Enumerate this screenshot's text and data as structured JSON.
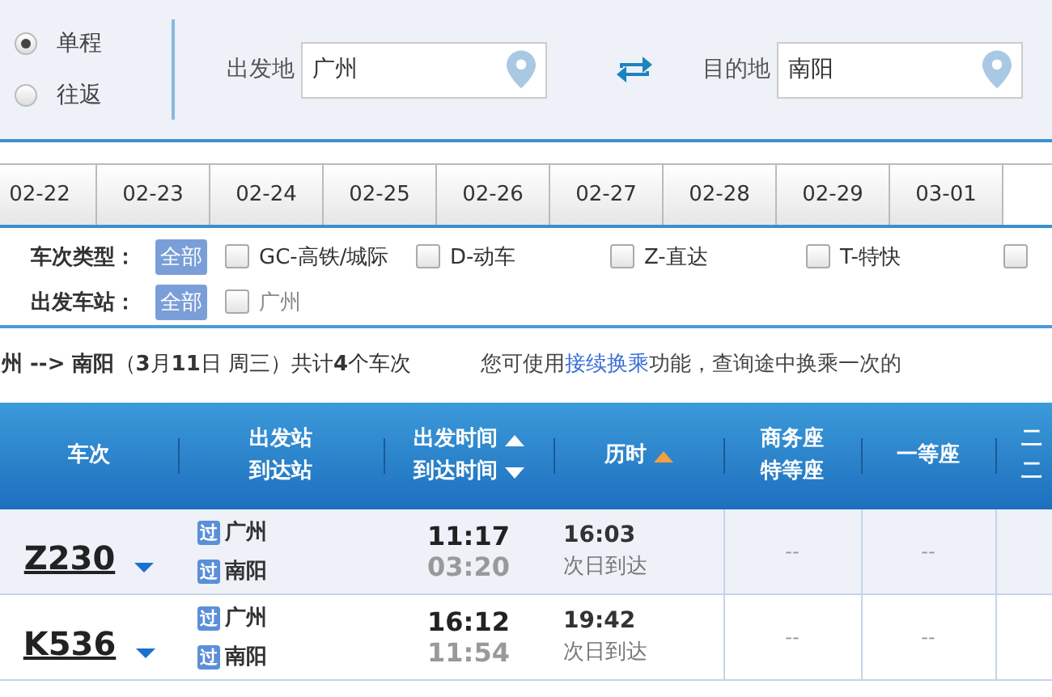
{
  "trip_type": [
    {
      "label": "单程",
      "selected": true
    },
    {
      "label": "往返",
      "selected": false
    }
  ],
  "from": {
    "label": "出发地",
    "value": "广州"
  },
  "to": {
    "label": "目的地",
    "value": "南阳"
  },
  "dates": [
    "02-22",
    "02-23",
    "02-24",
    "02-25",
    "02-26",
    "02-27",
    "02-28",
    "02-29",
    "03-01"
  ],
  "filters": [
    {
      "label": "车次类型：",
      "all": "全部",
      "options": [
        {
          "label": "GC-高铁/城际",
          "checked": false
        },
        {
          "label": "D-动车",
          "checked": false
        },
        {
          "label": "Z-直达",
          "checked": false
        },
        {
          "label": "T-特快",
          "checked": false
        },
        {
          "checked": false
        }
      ]
    },
    {
      "label": "出发车站：",
      "all": "全部",
      "options": [
        {
          "label": "广州",
          "checked": false
        }
      ]
    }
  ],
  "summary": {
    "text": "**州 --> 南阳**（**3**月**11**日  周三）共计**4**个车次",
    "hint_before": "您可使用",
    "hint_link": "接续换乘",
    "hint_after": "功能，查询途中换乘一次的"
  },
  "table": {
    "columns": [
      {
        "lines": [
          "车次"
        ],
        "kind": "plain"
      },
      {
        "lines": [
          "出发站",
          "到达站"
        ],
        "kind": "plain"
      },
      {
        "lines": [
          "出发时间",
          "到达时间"
        ],
        "kind": "updown"
      },
      {
        "lines": [
          "历时"
        ],
        "kind": "up"
      },
      {
        "lines": [
          "商务座",
          "特等座"
        ],
        "kind": "plain"
      },
      {
        "lines": [
          "一等座"
        ],
        "kind": "plain"
      },
      {
        "lines": [
          "二",
          "二"
        ],
        "kind": "cut"
      }
    ],
    "rows": [
      {
        "train": "Z230",
        "from_tag": "过",
        "from": "广州",
        "to_tag": "过",
        "to": "南阳",
        "depart": "11:17",
        "arrive": "03:20",
        "duration": "16:03",
        "arrival_day": "次日到达",
        "business": "--",
        "first": "--"
      },
      {
        "train": "K536",
        "from_tag": "过",
        "from": "广州",
        "to_tag": "过",
        "to": "南阳",
        "depart": "16:12",
        "arrive": "11:54",
        "duration": "19:42",
        "arrival_day": "次日到达",
        "business": "--",
        "first": "--"
      }
    ]
  }
}
